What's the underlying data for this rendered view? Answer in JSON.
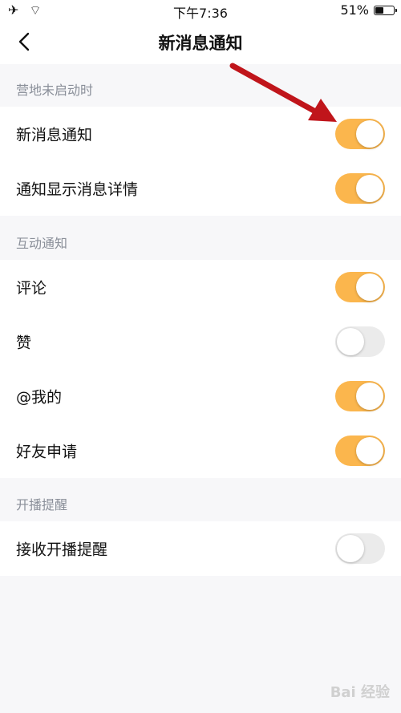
{
  "status_bar": {
    "left_icons": "✈ ⌔",
    "time": "下午7:36",
    "battery_text": "51%",
    "battery_level": 0.51
  },
  "nav": {
    "back_icon": "chevron-left-icon",
    "title": "新消息通知"
  },
  "sections": [
    {
      "header": "营地未启动时",
      "items": [
        {
          "label": "新消息通知",
          "on": true
        },
        {
          "label": "通知显示消息详情",
          "on": true
        }
      ]
    },
    {
      "header": "互动通知",
      "items": [
        {
          "label": "评论",
          "on": true
        },
        {
          "label": "赞",
          "on": false
        },
        {
          "label": "@我的",
          "on": true
        },
        {
          "label": "好友申请",
          "on": true
        }
      ]
    },
    {
      "header": "开播提醒",
      "items": [
        {
          "label": "接收开播提醒",
          "on": false
        }
      ]
    }
  ],
  "watermark": "Bai 经验",
  "colors": {
    "toggle_on": "#fbb64d",
    "toggle_off": "#ebebeb",
    "arrow": "#c0151b"
  }
}
